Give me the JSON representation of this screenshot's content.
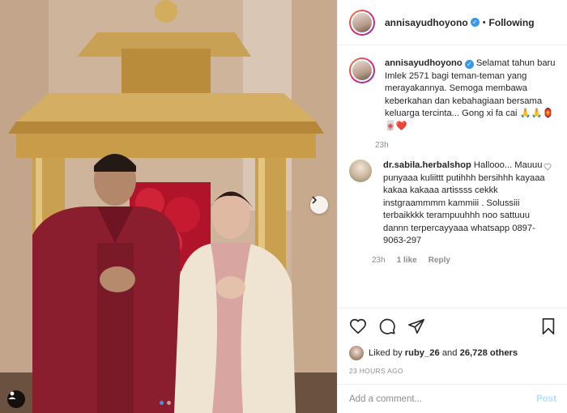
{
  "post": {
    "username": "annisayudhoyono",
    "follow_status": "Following",
    "separator": "•",
    "caption": "Selamat tahun baru Imlek 2571 bagi teman-teman yang merayakannya. Semoga membawa keberkahan dan kebahagiaan bersama keluarga tercinta... Gong xi fa cai 🙏🙏🏮🀄❤️",
    "caption_time": "23h",
    "comment": {
      "username": "dr.sabila.herbalshop",
      "text": "Hallooo... Mauuu punyaaa kuliittt putihhh bersihhh kayaaa kakaa kakaaa artissss cekkk instgraammmm kammiii . Solussiii terbaikkkk terampuuhhh noo sattuuu dannn terpercayyaaa whatsapp 0897-9063-297",
      "time": "23h",
      "likes": "1 like",
      "reply": "Reply"
    },
    "likes_prefix": "Liked by",
    "likes_user": "ruby_26",
    "likes_mid": "and",
    "likes_count": "26,728 others",
    "posted_ago": "23 HOURS AGO",
    "comment_placeholder": "Add a comment...",
    "post_label": "Post",
    "carousel": {
      "current": 1,
      "total": 2
    }
  },
  "icons": {
    "heart": "heart-icon",
    "comment": "comment-icon",
    "share": "share-icon",
    "save": "bookmark-icon"
  },
  "colors": {
    "accent": "#3897f0",
    "muted": "#8e8e8e",
    "like_red": "#ed4956"
  }
}
